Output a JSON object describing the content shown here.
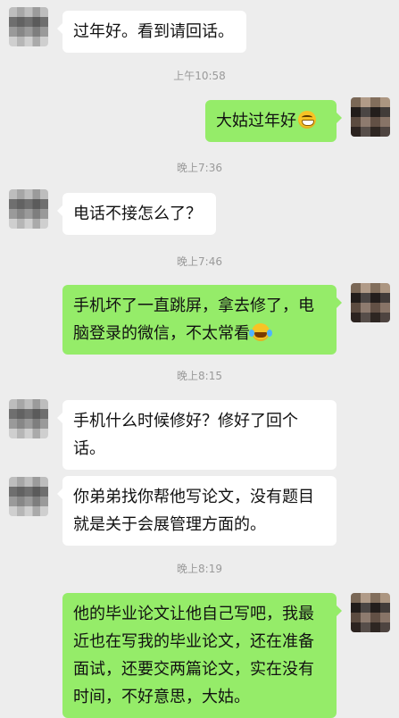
{
  "chat": {
    "messages": [
      {
        "side": "left",
        "text": "过年好。看到请回话。"
      },
      {
        "type": "timestamp",
        "text": "上午10:58"
      },
      {
        "side": "right",
        "text": "大姑过年好",
        "emoji": "grinning-emoji"
      },
      {
        "type": "timestamp",
        "text": "晚上7:36"
      },
      {
        "side": "left",
        "text": "电话不接怎么了？"
      },
      {
        "type": "timestamp",
        "text": "晚上7:46"
      },
      {
        "side": "right",
        "text": "手机坏了一直跳屏，拿去修了，电脑登录的微信，不太常看",
        "emoji": "laughing-crying-emoji"
      },
      {
        "type": "timestamp",
        "text": "晚上8:15"
      },
      {
        "side": "left",
        "text": "手机什么时候修好？修好了回个话。"
      },
      {
        "side": "left",
        "text": "你弟弟找你帮他写论文，没有题目就是关于会展管理方面的。"
      },
      {
        "type": "timestamp",
        "text": "晚上8:19"
      },
      {
        "side": "right",
        "text": "他的毕业论文让他自己写吧，我最近也在写我的毕业论文，还在准备面试，还要交两篇论文，实在没有时间，不好意思，大姑。"
      }
    ]
  },
  "colors": {
    "background": "#ededed",
    "incoming_bubble": "#ffffff",
    "outgoing_bubble": "#95ec69",
    "timestamp": "#9a9a9a"
  }
}
